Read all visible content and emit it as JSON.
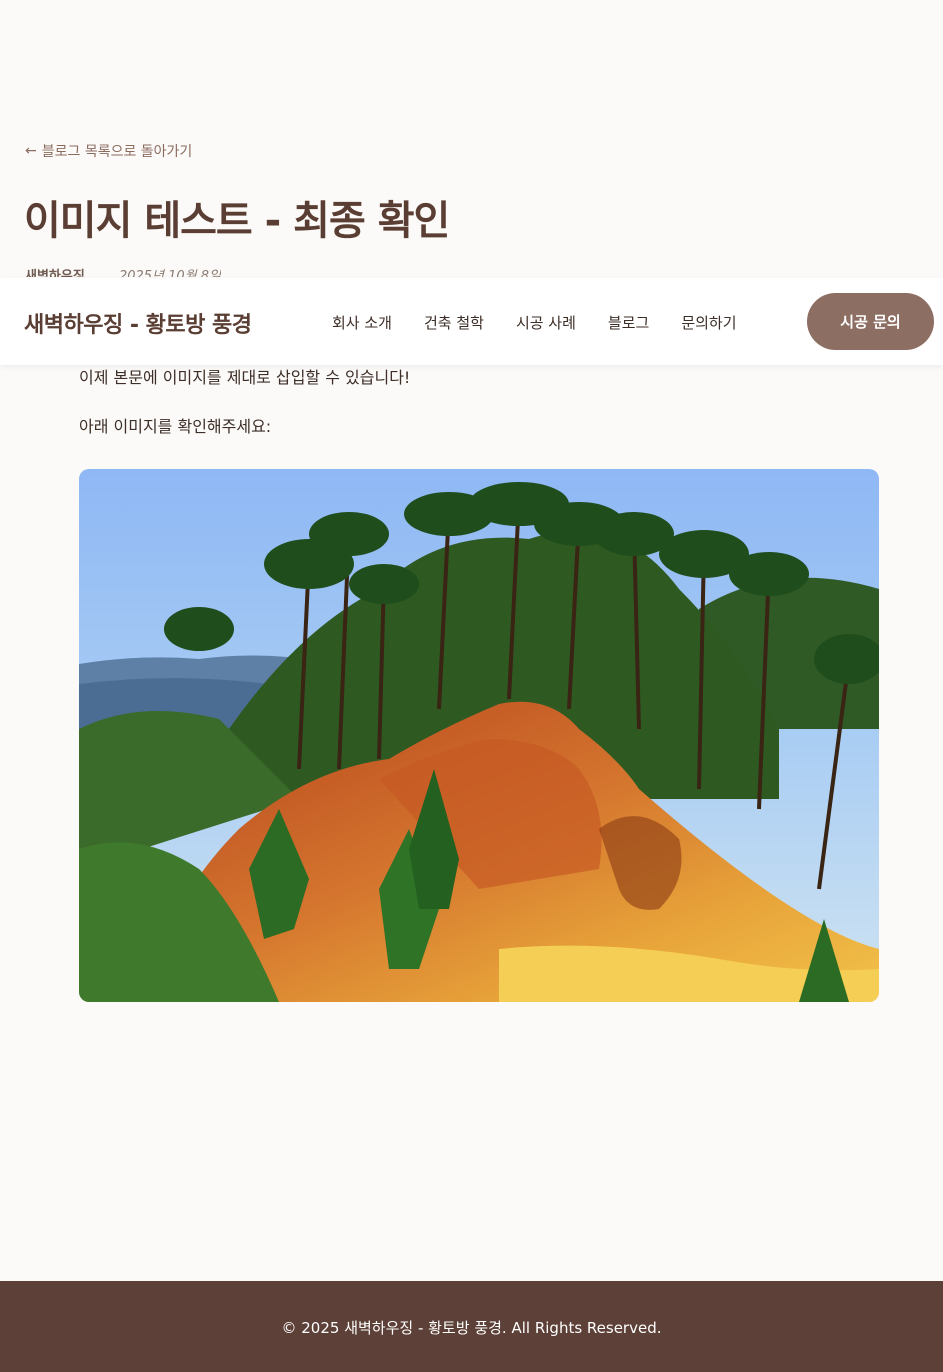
{
  "back_link": {
    "arrow": "←",
    "label": "블로그 목록으로 돌아가기"
  },
  "post": {
    "title": "이미지 테스트 - 최종 확인",
    "author": "새벽하우징",
    "date": "2025년 10월 8일",
    "paragraphs": [
      "이제 본문에 이미지를 제대로 삽입할 수 있습니다!",
      "아래 이미지를 확인해주세요:"
    ],
    "image_icon": "photo-landscape"
  },
  "header": {
    "brand": "새벽하우징 - 황토방 풍경",
    "nav": [
      "회사 소개",
      "건축 철학",
      "시공 사례",
      "블로그",
      "문의하기"
    ],
    "cta": "시공 문의"
  },
  "footer": {
    "copyright": "© 2025 새벽하우징 - 황토방 풍경. All Rights Reserved."
  },
  "colors": {
    "brand_brown": "#5a3e33",
    "cta_bg": "#8d6e63",
    "footer_bg": "#5d4037",
    "page_bg": "#fcfaf8"
  }
}
